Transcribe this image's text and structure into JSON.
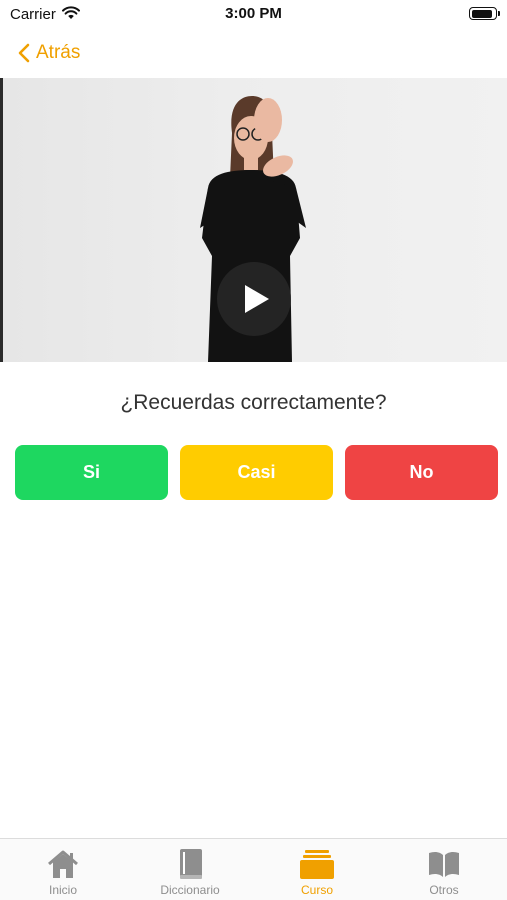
{
  "status_bar": {
    "carrier": "Carrier",
    "time": "3:00 PM",
    "battery_level": 0.9
  },
  "nav": {
    "back_label": "Atrás",
    "accent_color": "#f0a000"
  },
  "video": {
    "state": "paused",
    "play_icon": "play-icon"
  },
  "question": {
    "text": "¿Recuerdas correctamente?"
  },
  "answers": [
    {
      "label": "Si",
      "color": "#1ed760"
    },
    {
      "label": "Casi",
      "color": "#ffcc00"
    },
    {
      "label": "No",
      "color": "#ef4444"
    }
  ],
  "tab_bar": {
    "active_index": 2,
    "items": [
      {
        "label": "Inicio",
        "icon": "home-icon"
      },
      {
        "label": "Diccionario",
        "icon": "book-icon"
      },
      {
        "label": "Curso",
        "icon": "cards-icon"
      },
      {
        "label": "Otros",
        "icon": "open-book-icon"
      }
    ]
  }
}
